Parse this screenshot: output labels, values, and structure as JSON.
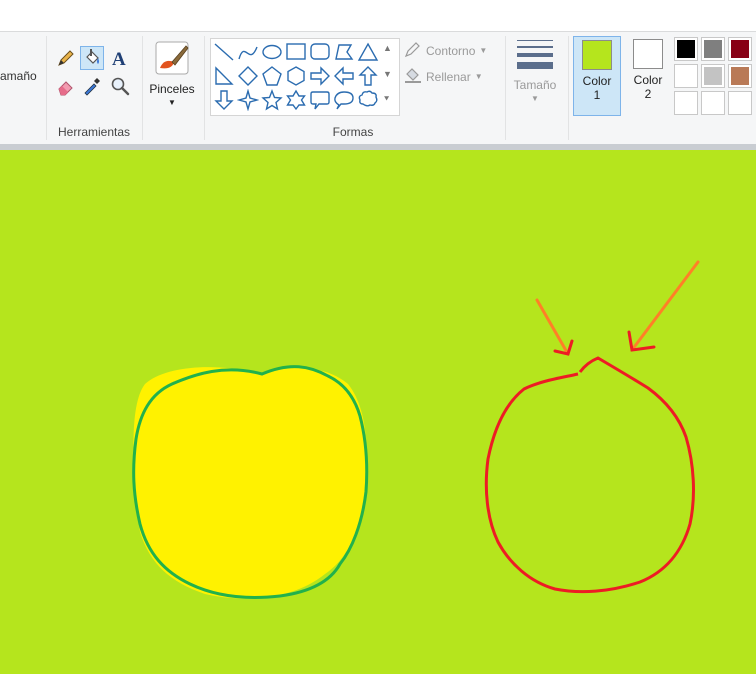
{
  "ribbon": {
    "cut_label": "amaño",
    "tools_group_label": "Herramientas",
    "brushes_label": "Pinceles",
    "shapes_group_label": "Formas",
    "outline_label": "Contorno",
    "fill_label": "Rellenar",
    "size_label": "Tamaño",
    "color1_label_line1": "Color",
    "color1_label_line2": "1",
    "color2_label_line1": "Color",
    "color2_label_line2": "2"
  },
  "colors": {
    "canvas_background": "#b5e51d",
    "color1": "#b5e51d",
    "color2": "#ffffff",
    "palette_row1": [
      "#000000",
      "#7f7f7f",
      "#880015"
    ],
    "palette_row2": [
      "#ffffff",
      "#c3c3c3",
      "#b97a57"
    ],
    "palette_row3": [
      "",
      "",
      ""
    ],
    "yellow_fill": "#fff200",
    "green_outline": "#22b14c",
    "red_outline": "#ed1c24",
    "arrow_orange": "#ff7f27"
  },
  "icons": {
    "tools": [
      "pencil-icon",
      "fill-bucket-icon",
      "text-icon",
      "eraser-icon",
      "color-picker-icon",
      "magnifier-icon"
    ],
    "shapes": [
      "line-icon",
      "curve-icon",
      "oval-icon",
      "rectangle-icon",
      "rounded-rectangle-icon",
      "polygon-icon",
      "triangle-icon",
      "right-triangle-icon",
      "diamond-icon",
      "pentagon-icon",
      "hexagon-icon",
      "right-arrow-icon",
      "left-arrow-icon",
      "up-arrow-icon",
      "down-arrow-icon",
      "four-point-star-icon",
      "five-point-star-icon",
      "six-point-star-icon",
      "rounded-callout-icon",
      "oval-callout-icon",
      "cloud-callout-icon"
    ]
  }
}
